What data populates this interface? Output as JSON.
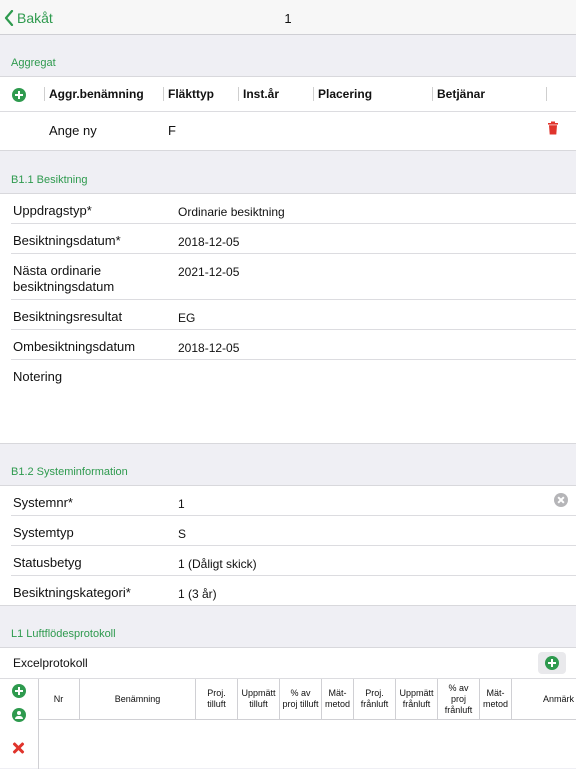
{
  "nav": {
    "back_label": "Bakåt",
    "title": "1"
  },
  "aggregat": {
    "header": "Aggregat",
    "columns": [
      "Aggr.benämning",
      "Fläkttyp",
      "Inst.år",
      "Placering",
      "Betjänar"
    ],
    "rows": [
      {
        "name": "Ange ny",
        "flakttyp": "F"
      }
    ]
  },
  "besiktning": {
    "header": "B1.1 Besiktning",
    "fields": [
      {
        "label": "Uppdragstyp*",
        "value": "Ordinarie besiktning"
      },
      {
        "label": "Besiktningsdatum*",
        "value": "2018-12-05"
      },
      {
        "label": "Nästa ordinarie besiktningsdatum",
        "value": "2021-12-05"
      },
      {
        "label": "Besiktningsresultat",
        "value": "EG"
      },
      {
        "label": "Ombesiktningsdatum",
        "value": "2018-12-05"
      },
      {
        "label": "Notering",
        "value": ""
      }
    ]
  },
  "systeminfo": {
    "header": "B1.2 Systeminformation",
    "fields": [
      {
        "label": "Systemnr*",
        "value": "1"
      },
      {
        "label": "Systemtyp",
        "value": "S"
      },
      {
        "label": "Statusbetyg",
        "value": "1 (Dåligt skick)"
      },
      {
        "label": "Besiktningskategori*",
        "value": "1 (3 år)"
      }
    ]
  },
  "luftflode": {
    "header": "L1 Luftflödesprotokoll",
    "excel_label": "Excelprotokoll",
    "columns": [
      "Nr",
      "Benämning",
      "Proj. tilluft",
      "Uppmätt tilluft",
      "% av proj tilluft",
      "Mät-metod",
      "Proj. frånluft",
      "Uppmätt frånluft",
      "% av proj frånluft",
      "Mät-metod",
      "Anmärk"
    ]
  },
  "colors": {
    "accent": "#2e9a4e",
    "danger": "#e0342c",
    "background": "#efeff4"
  },
  "icons": [
    "chevron-left-icon",
    "plus-circle-icon",
    "trash-icon",
    "clear-icon",
    "person-icon",
    "delete-x-icon"
  ]
}
